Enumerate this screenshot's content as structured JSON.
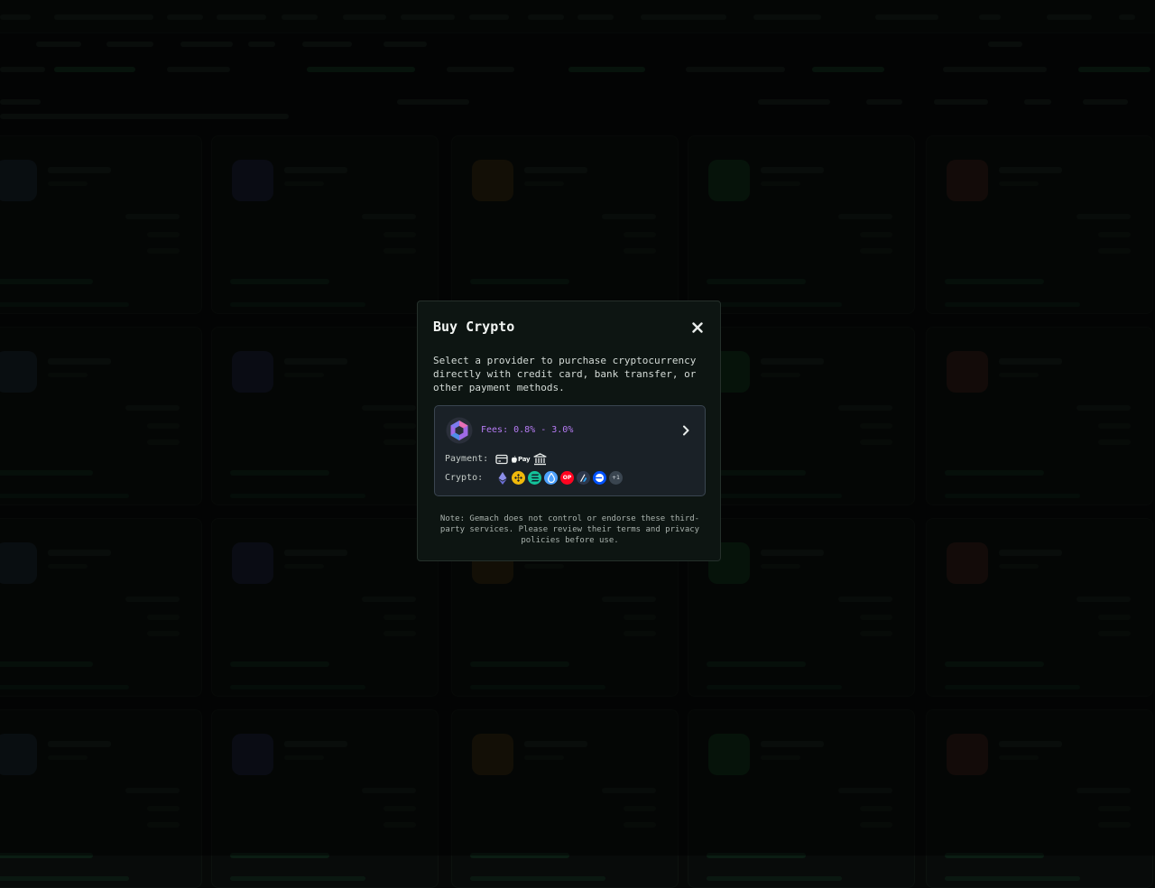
{
  "modal": {
    "title": "Buy Crypto",
    "description": "Select a provider to purchase cryptocurrency directly with credit card, bank transfer, or other payment methods.",
    "note": "Note: Gemach does not control or endorse these third-party services. Please review their terms and privacy policies before use."
  },
  "provider": {
    "fees": "Fees: 0.8% - 3.0%",
    "payment_label": "Payment:",
    "crypto_label": "Crypto:",
    "payment_methods": [
      "card-icon",
      "apple-pay-icon",
      "bank-icon"
    ],
    "apple_pay_text": "Pay",
    "crypto_icons": [
      "ethereum-icon",
      "bnb-icon",
      "solana-icon",
      "sui-icon",
      "optimism-icon",
      "arbitrum-icon",
      "base-icon"
    ],
    "op_text": "OP",
    "more_count": "+1"
  },
  "colors": {
    "fees_accent": "#b77cf5",
    "card_background": "#1a2127",
    "modal_background": "#0d1512"
  }
}
